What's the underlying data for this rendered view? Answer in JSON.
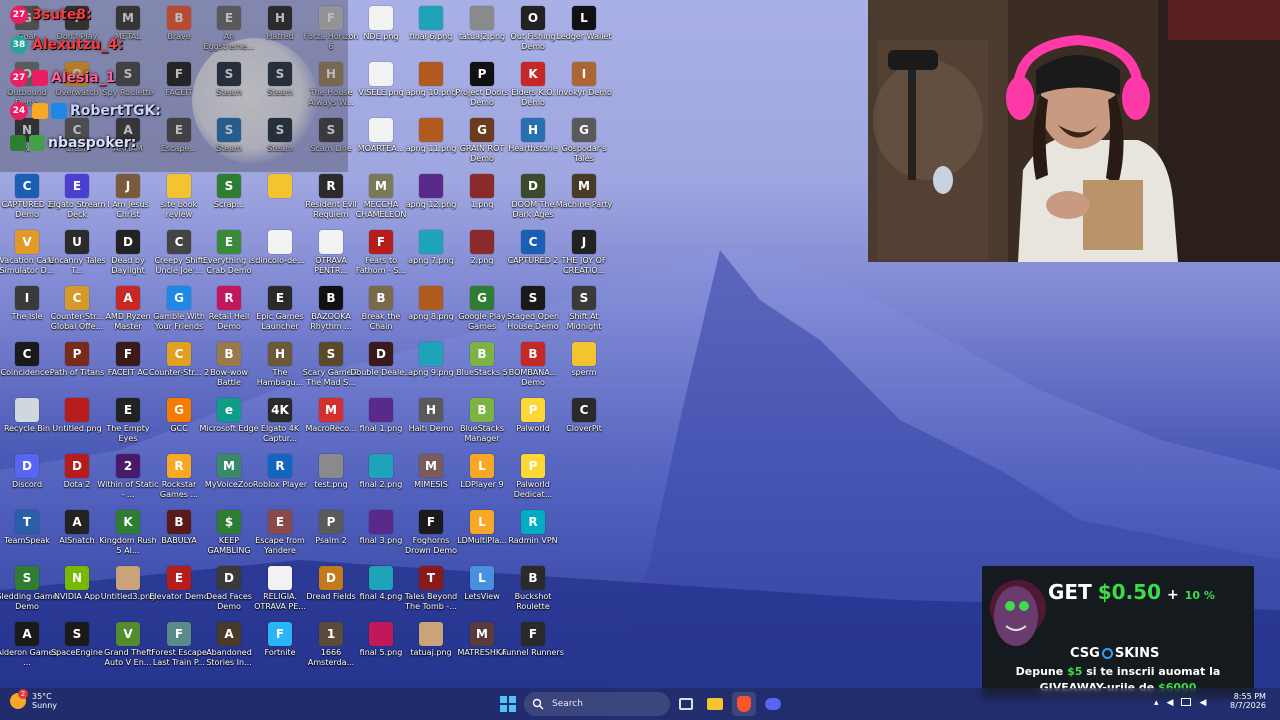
{
  "desktop": {
    "icons": [
      {
        "label": "Goat",
        "glyph": "G",
        "color": "#5a5a5a"
      },
      {
        "label": "Don't Play",
        "glyph": "?",
        "color": "#2b2b2b"
      },
      {
        "label": "METAL",
        "glyph": "M",
        "color": "#333333"
      },
      {
        "label": "Brave",
        "glyph": "B",
        "color": "#fb542b"
      },
      {
        "label": "An Eggstreme...",
        "glyph": "E",
        "color": "#6a6a6a"
      },
      {
        "label": "Hatred",
        "glyph": "H",
        "color": "#222222"
      },
      {
        "label": "Forza Horizon 6",
        "glyph": "F",
        "color": "#c2c2c2"
      },
      {
        "label": "NDE.png",
        "glyph": "",
        "color": "#f2f2f2"
      },
      {
        "label": "final 6.png",
        "glyph": "",
        "color": "#1fa3b8"
      },
      {
        "label": "tatuaj2.png",
        "glyph": "",
        "color": "#8a8a8a"
      },
      {
        "label": "Out Fishing Demo",
        "glyph": "O",
        "color": "#222222"
      },
      {
        "label": "Ledger Wallet",
        "glyph": "L",
        "color": "#111111"
      },
      {
        "label": "Outbound Demo",
        "glyph": "O",
        "color": "#6b6b6b"
      },
      {
        "label": "Overwatch",
        "glyph": "O",
        "color": "#f99e1a"
      },
      {
        "label": "Spy Roulette",
        "glyph": "S",
        "color": "#444444"
      },
      {
        "label": "FACEIT",
        "glyph": "F",
        "color": "#1a1a1a"
      },
      {
        "label": "Steam",
        "glyph": "S",
        "color": "#1b2838"
      },
      {
        "label": "Steam",
        "glyph": "S",
        "color": "#1b2838"
      },
      {
        "label": "The House Always W...",
        "glyph": "H",
        "color": "#9b7e57"
      },
      {
        "label": "VISELE.png",
        "glyph": "",
        "color": "#f2f2f2"
      },
      {
        "label": "apng 10.png",
        "glyph": "",
        "color": "#b05a1f"
      },
      {
        "label": "Project Doors Demo",
        "glyph": "P",
        "color": "#111111"
      },
      {
        "label": "Elders K.O. Demo",
        "glyph": "K",
        "color": "#c62828"
      },
      {
        "label": "Invokyr Demo",
        "glyph": "I",
        "color": "#aa6633"
      },
      {
        "label": "N",
        "glyph": "N",
        "color": "#2b2b2b"
      },
      {
        "label": "Crash",
        "glyph": "C",
        "color": "#555555"
      },
      {
        "label": "ARHAM",
        "glyph": "A",
        "color": "#333333"
      },
      {
        "label": "Escape...",
        "glyph": "E",
        "color": "#444444"
      },
      {
        "label": "Steam",
        "glyph": "S",
        "color": "#1b6fb5"
      },
      {
        "label": "Steam",
        "glyph": "S",
        "color": "#1b2838"
      },
      {
        "label": "Scam Line",
        "glyph": "S",
        "color": "#3a3a3a"
      },
      {
        "label": "MOARTEA...",
        "glyph": "",
        "color": "#f2f2f2"
      },
      {
        "label": "apng 11.png",
        "glyph": "",
        "color": "#b05a1f"
      },
      {
        "label": "GRAIN ROT Demo",
        "glyph": "G",
        "color": "#6b3a1f"
      },
      {
        "label": "Hearthstone",
        "glyph": "H",
        "color": "#2a6fb0"
      },
      {
        "label": "Gospodar's Tales",
        "glyph": "G",
        "color": "#5a5a5a"
      },
      {
        "label": "CAPTURED 2 Demo",
        "glyph": "C",
        "color": "#1a5fb4"
      },
      {
        "label": "Elgato Stream Deck",
        "glyph": "E",
        "color": "#4b3fd1"
      },
      {
        "label": "I Am Jesus Christ",
        "glyph": "J",
        "color": "#7a5a3a"
      },
      {
        "label": "site book review",
        "glyph": "",
        "color": "#f4c430"
      },
      {
        "label": "Scrap...",
        "glyph": "S",
        "color": "#2e7d32"
      },
      {
        "label": "",
        "glyph": "",
        "color": "#f4c430"
      },
      {
        "label": "Resident Evil Requiem",
        "glyph": "R",
        "color": "#2b2b2b"
      },
      {
        "label": "MECCHA CHAMELEON",
        "glyph": "M",
        "color": "#7a7a5a"
      },
      {
        "label": "apng 12.png",
        "glyph": "",
        "color": "#5a2a8a"
      },
      {
        "label": "1.png",
        "glyph": "",
        "color": "#8a2a2a"
      },
      {
        "label": "DOOM The Dark Ages",
        "glyph": "D",
        "color": "#3a4a2a"
      },
      {
        "label": "Machine Party",
        "glyph": "M",
        "color": "#4a3a2a"
      },
      {
        "label": "Vacation Cafe Simulator D...",
        "glyph": "V",
        "color": "#e09a2a"
      },
      {
        "label": "Uncanny Tales T...",
        "glyph": "U",
        "color": "#2b2b2b"
      },
      {
        "label": "Dead by Daylight",
        "glyph": "D",
        "color": "#222222"
      },
      {
        "label": "Creepy Shift Uncle Joe'...",
        "glyph": "C",
        "color": "#444444"
      },
      {
        "label": "Everything is Crab Demo",
        "glyph": "E",
        "color": "#3a8a3a"
      },
      {
        "label": "dincolo-de...",
        "glyph": "",
        "color": "#f2f2f2"
      },
      {
        "label": "OTRAVA PENTR...",
        "glyph": "",
        "color": "#f2f2f2"
      },
      {
        "label": "Fears to Fathom - S...",
        "glyph": "F",
        "color": "#b71c1c"
      },
      {
        "label": "apng 7.png",
        "glyph": "",
        "color": "#1fa3b8"
      },
      {
        "label": "2.png",
        "glyph": "",
        "color": "#8a2a2a"
      },
      {
        "label": "CAPTURED 2",
        "glyph": "C",
        "color": "#1a5fb4"
      },
      {
        "label": "THE JOY OF CREATIO...",
        "glyph": "J",
        "color": "#222222"
      },
      {
        "label": "The Isle",
        "glyph": "I",
        "color": "#3a3a3a"
      },
      {
        "label": "Counter-Str... Global Offe...",
        "glyph": "C",
        "color": "#d49a2a"
      },
      {
        "label": "AMD Ryzen Master",
        "glyph": "A",
        "color": "#c62828"
      },
      {
        "label": "Gamble With Your Friends",
        "glyph": "G",
        "color": "#1e88e5"
      },
      {
        "label": "Retail Hell Demo",
        "glyph": "R",
        "color": "#c2185b"
      },
      {
        "label": "Epic Games Launcher",
        "glyph": "E",
        "color": "#2a2a2a"
      },
      {
        "label": "BAZOOKA Rhythm ...",
        "glyph": "B",
        "color": "#111111"
      },
      {
        "label": "Break the Chain",
        "glyph": "B",
        "color": "#7a6a4a"
      },
      {
        "label": "apng 8.png",
        "glyph": "",
        "color": "#b05a1f"
      },
      {
        "label": "Google Play Games",
        "glyph": "G",
        "color": "#2e7d32"
      },
      {
        "label": "Staged Open House Demo",
        "glyph": "S",
        "color": "#1a1a1a"
      },
      {
        "label": "Shift At Midnight",
        "glyph": "S",
        "color": "#3a3a3a"
      },
      {
        "label": "Coincidences",
        "glyph": "C",
        "color": "#1a1a1a"
      },
      {
        "label": "Path of Titans",
        "glyph": "P",
        "color": "#7a2a1a"
      },
      {
        "label": "FACEIT AC",
        "glyph": "F",
        "color": "#3a1a1a"
      },
      {
        "label": "Counter-Str... 2",
        "glyph": "C",
        "color": "#e0a020"
      },
      {
        "label": "Bow-wow Battle",
        "glyph": "B",
        "color": "#9a7a4a"
      },
      {
        "label": "The Hambagu...",
        "glyph": "H",
        "color": "#6a5a3a"
      },
      {
        "label": "Scary Game 2 The Mad S...",
        "glyph": "S",
        "color": "#5a4a2a"
      },
      {
        "label": "Double Deale...",
        "glyph": "D",
        "color": "#3a1a1a"
      },
      {
        "label": "apng 9.png",
        "glyph": "",
        "color": "#1fa3b8"
      },
      {
        "label": "BlueStacks 5",
        "glyph": "B",
        "color": "#7cb342"
      },
      {
        "label": "BOMBANA... Demo",
        "glyph": "B",
        "color": "#c62828"
      },
      {
        "label": "sperm",
        "glyph": "",
        "color": "#f4c430"
      },
      {
        "label": "Recycle Bin",
        "glyph": "",
        "color": "#cfd8dc"
      },
      {
        "label": "Untitled.png",
        "glyph": "",
        "color": "#b71c1c"
      },
      {
        "label": "The Empty Eyes",
        "glyph": "E",
        "color": "#222222"
      },
      {
        "label": "GCC",
        "glyph": "G",
        "color": "#f57c00"
      },
      {
        "label": "Microsoft Edge",
        "glyph": "e",
        "color": "#0f9d8a"
      },
      {
        "label": "Elgato 4K Captur...",
        "glyph": "4K",
        "color": "#2a2a2a"
      },
      {
        "label": "MacroReco...",
        "glyph": "M",
        "color": "#d32f2f"
      },
      {
        "label": "final 1.png",
        "glyph": "",
        "color": "#5a2a8a"
      },
      {
        "label": "Haiti Demo",
        "glyph": "H",
        "color": "#5a5a5a"
      },
      {
        "label": "BlueStacks Manager",
        "glyph": "B",
        "color": "#7cb342"
      },
      {
        "label": "Palworld",
        "glyph": "P",
        "color": "#fdd835"
      },
      {
        "label": "CloverPit",
        "glyph": "C",
        "color": "#2a2a2a"
      },
      {
        "label": "Discord",
        "glyph": "D",
        "color": "#5865f2"
      },
      {
        "label": "Dota 2",
        "glyph": "D",
        "color": "#b71c1c"
      },
      {
        "label": "Within of Static - ...",
        "glyph": "2",
        "color": "#4a1a6a"
      },
      {
        "label": "Rockstar Games ...",
        "glyph": "R",
        "color": "#f9a825"
      },
      {
        "label": "MyVoiceZoo",
        "glyph": "M",
        "color": "#3a8a6a"
      },
      {
        "label": "Roblox Player",
        "glyph": "R",
        "color": "#1565c0"
      },
      {
        "label": "test.png",
        "glyph": "",
        "color": "#8a8a8a"
      },
      {
        "label": "final 2.png",
        "glyph": "",
        "color": "#1fa3b8"
      },
      {
        "label": "MIMESIS",
        "glyph": "M",
        "color": "#7a5a5a"
      },
      {
        "label": "LDPlayer 9",
        "glyph": "L",
        "color": "#f9a825"
      },
      {
        "label": "Palworld Dedicat...",
        "glyph": "P",
        "color": "#fdd835"
      },
      {
        "label": "TeamSpeak",
        "glyph": "T",
        "color": "#2a5fa8"
      },
      {
        "label": "AISnatch",
        "glyph": "A",
        "color": "#222222"
      },
      {
        "label": "Kingdom Rush 5 Al...",
        "glyph": "K",
        "color": "#2e7d32"
      },
      {
        "label": "BABULYA",
        "glyph": "B",
        "color": "#5a1a1a"
      },
      {
        "label": "KEEP GAMBLING",
        "glyph": "$",
        "color": "#2e7d32"
      },
      {
        "label": "Escape from Yandere",
        "glyph": "E",
        "color": "#8a4a4a"
      },
      {
        "label": "Psalm 2",
        "glyph": "P",
        "color": "#5a5a5a"
      },
      {
        "label": "final 3.png",
        "glyph": "",
        "color": "#5a2a8a"
      },
      {
        "label": "Foghorns Drown Demo",
        "glyph": "F",
        "color": "#1a1a1a"
      },
      {
        "label": "LDMultiPla...",
        "glyph": "L",
        "color": "#f9a825"
      },
      {
        "label": "Radmin VPN",
        "glyph": "R",
        "color": "#00acc1"
      },
      {
        "label": "Sledding Game Demo",
        "glyph": "S",
        "color": "#2e7d32"
      },
      {
        "label": "NVIDIA App",
        "glyph": "N",
        "color": "#76b900"
      },
      {
        "label": "Untitled3.png",
        "glyph": "",
        "color": "#caa37a"
      },
      {
        "label": "Elevator Demo",
        "glyph": "E",
        "color": "#b71c1c"
      },
      {
        "label": "Dead Faces Demo",
        "glyph": "D",
        "color": "#3a3a3a"
      },
      {
        "label": "RELIGIA. OTRAVA PE...",
        "glyph": "",
        "color": "#f2f2f2"
      },
      {
        "label": "Dread Fields",
        "glyph": "D",
        "color": "#c27a1a"
      },
      {
        "label": "final 4.png",
        "glyph": "",
        "color": "#1fa3b8"
      },
      {
        "label": "Tales Beyond The Tomb -...",
        "glyph": "T",
        "color": "#8a1a1a"
      },
      {
        "label": "LetsView",
        "glyph": "L",
        "color": "#4a90e2"
      },
      {
        "label": "Buckshot Roulette",
        "glyph": "B",
        "color": "#2a2a2a"
      },
      {
        "label": "Alderon Games ...",
        "glyph": "A",
        "color": "#1a1a1a"
      },
      {
        "label": "SpaceEngine",
        "glyph": "S",
        "color": "#1a1a1a"
      },
      {
        "label": "Grand Theft Auto V En...",
        "glyph": "V",
        "color": "#558b2f"
      },
      {
        "label": "Forest Escape Last Train P...",
        "glyph": "F",
        "color": "#5a8a8a"
      },
      {
        "label": "Abandoned Stories In...",
        "glyph": "A",
        "color": "#4a3a2a"
      },
      {
        "label": "Fortnite",
        "glyph": "F",
        "color": "#29b6f6"
      },
      {
        "label": "1666 Amsterda...",
        "glyph": "1",
        "color": "#5a4a3a"
      },
      {
        "label": "final 5.png",
        "glyph": "",
        "color": "#c2185b"
      },
      {
        "label": "tatuaj.png",
        "glyph": "",
        "color": "#caa37a"
      },
      {
        "label": "MATRESHKA",
        "glyph": "M",
        "color": "#5a3a3a"
      },
      {
        "label": "Funnel Runners",
        "glyph": "F",
        "color": "#2a2a2a"
      }
    ]
  },
  "chat": {
    "rows": [
      {
        "badge": "27",
        "badge_color": "#e91e63",
        "name": "3sute8:",
        "name_color": "#ff3b3b"
      },
      {
        "badge": "38",
        "badge_color": "#26a69a",
        "name": "Alexutzu_4:",
        "name_color": "#ff3b3b"
      },
      {
        "badge": "27",
        "badge_color": "#e91e63",
        "name": "Alesia_1",
        "name_color": "#ff5c9a"
      },
      {
        "badge": "24",
        "badge_color": "#e91e63",
        "name": "RobertTGK:",
        "name_color": "#c8d3ff"
      },
      {
        "badge": "",
        "badge_color": "#2e7d32",
        "name": "nbaspoker:",
        "name_color": "#d8e0ff"
      }
    ]
  },
  "promo": {
    "headline_get": "GET",
    "headline_amount": "$0.50",
    "headline_plus": "+",
    "headline_percent": "10 %",
    "brand": "CSG",
    "brand_suffix": "SKINS",
    "line1_pre": "Depune ",
    "line1_amount": "$5",
    "line1_post": " si te inscrii auomat la",
    "line2_pre": "GIVEAWAY-urile de ",
    "line2_amount": "$6000",
    "accent": "#3ddc4a"
  },
  "taskbar": {
    "search_placeholder": "Search",
    "weather_temp": "35°C",
    "weather_desc": "Sunny",
    "time": "8:55 PM",
    "date": "8/7/2026",
    "notification_count": "2"
  }
}
